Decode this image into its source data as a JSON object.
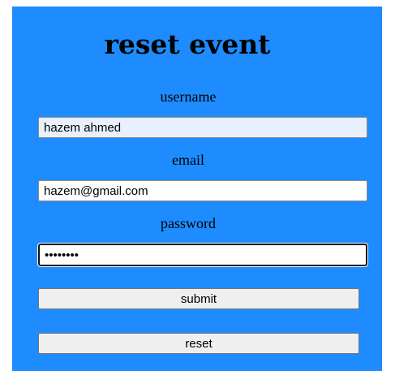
{
  "form": {
    "title": "reset event",
    "username": {
      "label": "username",
      "value": "hazem ahmed"
    },
    "email": {
      "label": "email",
      "value": "hazem@gmail.com"
    },
    "password": {
      "label": "password",
      "value": "12345678"
    },
    "submit_label": "submit",
    "reset_label": "reset"
  },
  "colors": {
    "panel_background": "#1e8cff",
    "page_background": "#ffffff",
    "autofill_background": "#e8f0fe",
    "button_background": "#efefef"
  }
}
